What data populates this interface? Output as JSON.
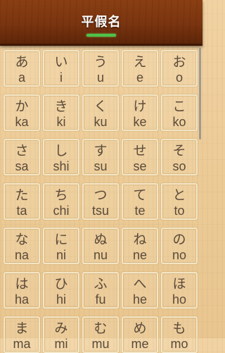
{
  "header": {
    "title": "平假名"
  },
  "kana": [
    {
      "kana": "あ",
      "romaji": "a"
    },
    {
      "kana": "い",
      "romaji": "i"
    },
    {
      "kana": "う",
      "romaji": "u"
    },
    {
      "kana": "え",
      "romaji": "e"
    },
    {
      "kana": "お",
      "romaji": "o"
    },
    {
      "kana": "か",
      "romaji": "ka"
    },
    {
      "kana": "き",
      "romaji": "ki"
    },
    {
      "kana": "く",
      "romaji": "ku"
    },
    {
      "kana": "け",
      "romaji": "ke"
    },
    {
      "kana": "こ",
      "romaji": "ko"
    },
    {
      "kana": "さ",
      "romaji": "sa"
    },
    {
      "kana": "し",
      "romaji": "shi"
    },
    {
      "kana": "す",
      "romaji": "su"
    },
    {
      "kana": "せ",
      "romaji": "se"
    },
    {
      "kana": "そ",
      "romaji": "so"
    },
    {
      "kana": "た",
      "romaji": "ta"
    },
    {
      "kana": "ち",
      "romaji": "chi"
    },
    {
      "kana": "つ",
      "romaji": "tsu"
    },
    {
      "kana": "て",
      "romaji": "te"
    },
    {
      "kana": "と",
      "romaji": "to"
    },
    {
      "kana": "な",
      "romaji": "na"
    },
    {
      "kana": "に",
      "romaji": "ni"
    },
    {
      "kana": "ぬ",
      "romaji": "nu"
    },
    {
      "kana": "ね",
      "romaji": "ne"
    },
    {
      "kana": "の",
      "romaji": "no"
    },
    {
      "kana": "は",
      "romaji": "ha"
    },
    {
      "kana": "ひ",
      "romaji": "hi"
    },
    {
      "kana": "ふ",
      "romaji": "fu"
    },
    {
      "kana": "へ",
      "romaji": "he"
    },
    {
      "kana": "ほ",
      "romaji": "ho"
    },
    {
      "kana": "ま",
      "romaji": "ma"
    },
    {
      "kana": "み",
      "romaji": "mi"
    },
    {
      "kana": "む",
      "romaji": "mu"
    },
    {
      "kana": "め",
      "romaji": "me"
    },
    {
      "kana": "も",
      "romaji": "mo"
    }
  ],
  "colors": {
    "header": "#7a3410",
    "indicator": "#4fc14a",
    "text": "#5b4a3a",
    "background": "#eccb97"
  }
}
